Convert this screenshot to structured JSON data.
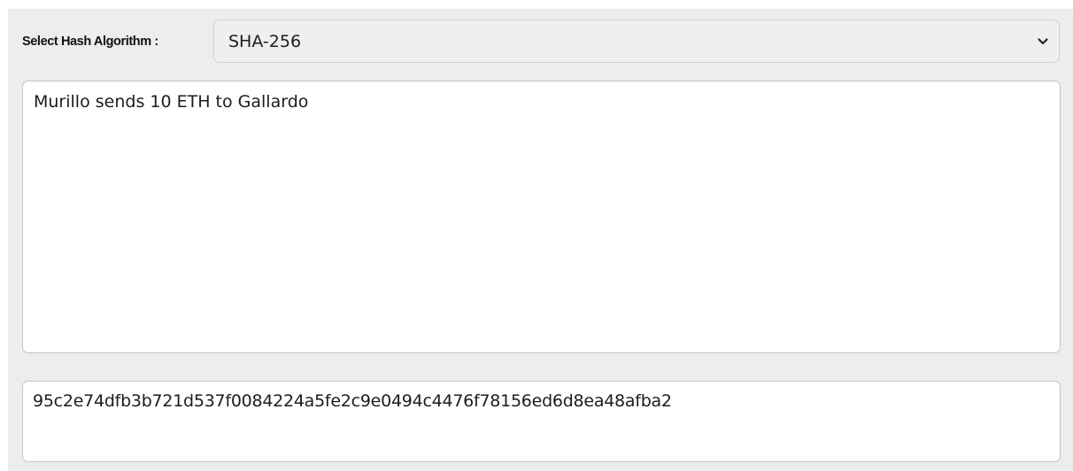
{
  "hash_form": {
    "algorithm_label": "Select Hash Algorithm :",
    "algorithm_selected": "SHA-256",
    "chevron_icon": "chevron-down-icon",
    "message_text": "Murillo sends 10 ETH to Gallardo",
    "hash_output": "95c2e74dfb3b721d537f0084224a5fe2c9e0494c4476f78156ed6d8ea48afba2"
  }
}
